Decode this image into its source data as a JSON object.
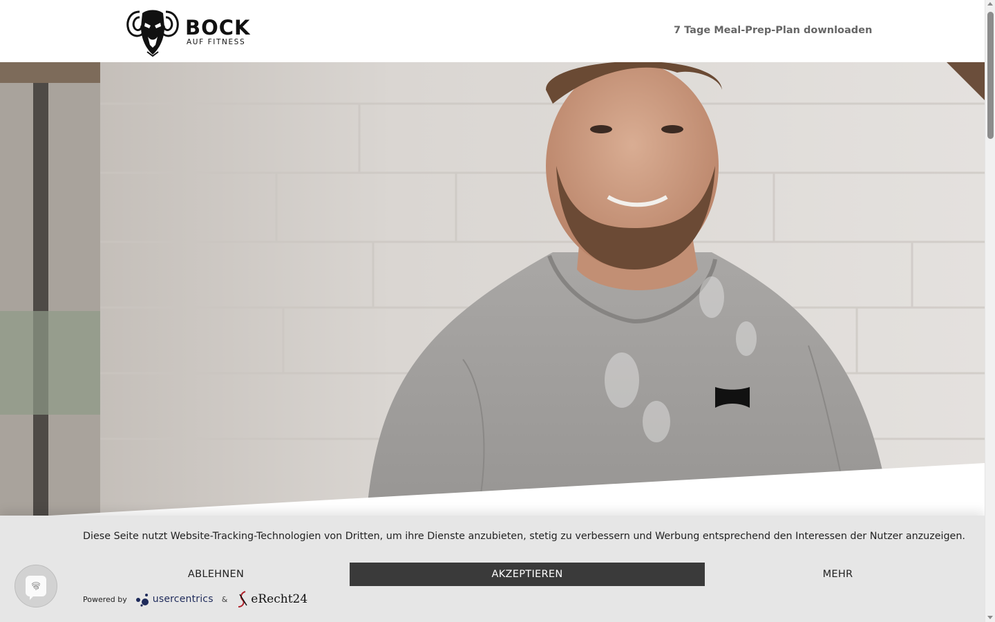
{
  "header": {
    "logo_main": "BOCK",
    "logo_sub": "AUF FITNESS",
    "cta_label": "7 Tage Meal-Prep-Plan downloaden"
  },
  "hero": {
    "image": "portrait-man-grey-shirt-brick-wall"
  },
  "cookie_banner": {
    "message": "Diese Seite nutzt Website-Tracking-Technologien von Dritten, um ihre Dienste anzubieten, stetig zu verbessern und Werbung entsprechend den Interessen der Nutzer anzuzeigen.",
    "deny_label": "ABLEHNEN",
    "accept_label": "AKZEPTIEREN",
    "more_label": "MEHR",
    "powered_by": "Powered by",
    "provider_1": "usercentrics",
    "separator": "&",
    "provider_2": "eRecht24"
  },
  "privacy_button": {
    "icon": "fingerprint-icon"
  },
  "colors": {
    "accept_bg": "#3a3a3a",
    "banner_bg": "#e6e6e6",
    "cta_text": "#666666"
  }
}
